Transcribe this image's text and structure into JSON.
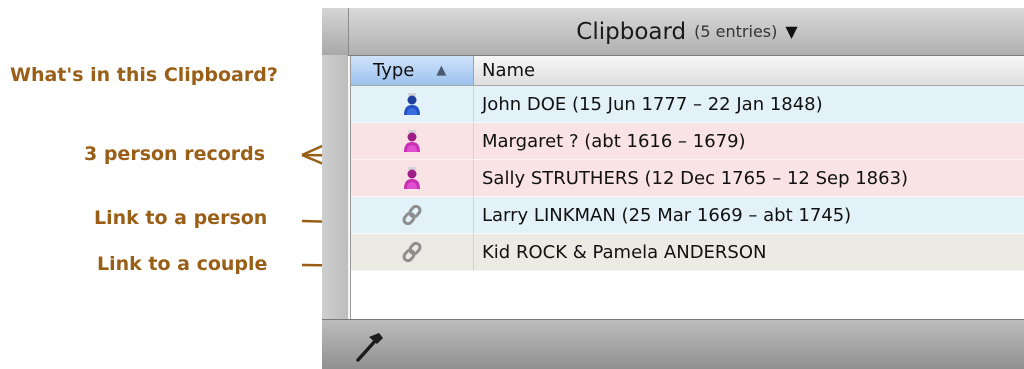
{
  "annotations": {
    "whats_in": "What's in this Clipboard?",
    "person_records": "3 person records",
    "link_person": "Link to a person",
    "link_couple": "Link to a couple"
  },
  "panel": {
    "title": "Clipboard",
    "entry_count": "(5 entries)",
    "columns": {
      "type": "Type",
      "name": "Name"
    },
    "rows": [
      {
        "icon": "person-male-icon",
        "name": "John DOE (15 Jun 1777 – 22 Jan 1848)"
      },
      {
        "icon": "person-female-icon",
        "name": "Margaret ? (abt 1616 – 1679)"
      },
      {
        "icon": "person-female-icon",
        "name": "Sally STRUTHERS (12 Dec 1765 – 12 Sep 1863)"
      },
      {
        "icon": "link-icon",
        "name": "Larry LINKMAN (25 Mar 1669 – abt 1745)"
      },
      {
        "icon": "link-icon",
        "name": "Kid ROCK & Pamela ANDERSON"
      }
    ],
    "toolbar_icon": "hammer-icon"
  },
  "colors": {
    "annotation": "#9a5f17",
    "row_person": "#e3f1f8",
    "row_female": "#f9e3e5",
    "row_couple": "#ecebe3",
    "header_selected": "#9cc2ee"
  }
}
